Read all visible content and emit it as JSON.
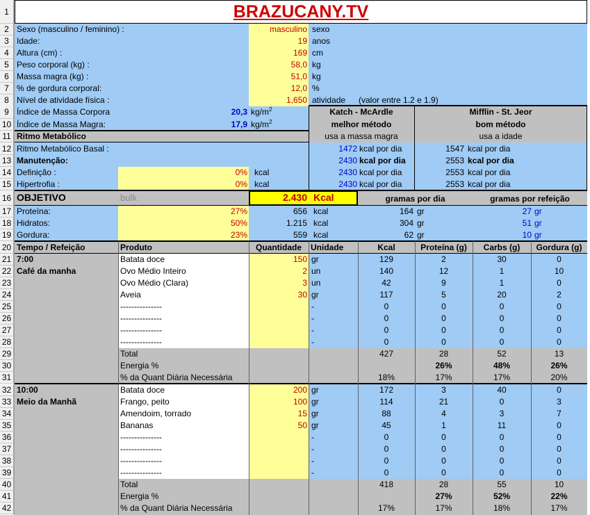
{
  "title": "BRAZUCANY.TV",
  "profile": [
    {
      "label": "Sexo (masculino / feminino) :",
      "value": "masculino",
      "unit": "sexo"
    },
    {
      "label": "Idade:",
      "value": "19",
      "unit": "anos"
    },
    {
      "label": "Altura (cm) :",
      "value": "169",
      "unit": "cm"
    },
    {
      "label": "Peso corporal (kg) :",
      "value": "58,0",
      "unit": "kg"
    },
    {
      "label": "Massa magra (kg) :",
      "value": "51,0",
      "unit": "kg"
    },
    {
      "label": "% de gordura corporal:",
      "value": "12,0",
      "unit": "%"
    },
    {
      "label": "Nível de atividade física :",
      "value": "1,650",
      "unit": "atividade",
      "note": "(valor entre 1.2 e 1.9)"
    }
  ],
  "indices": [
    {
      "label": "Índice de Massa Corpora",
      "value": "20,3",
      "unit": "kg/m",
      "exp": "2"
    },
    {
      "label": "Índice de Massa Magra:",
      "value": "17,9",
      "unit": "kg/m",
      "exp": "2"
    }
  ],
  "methods": {
    "katch": {
      "name": "Katch - McArdle",
      "quality": "melhor método",
      "basis": "usa a massa magra"
    },
    "mifflin": {
      "name": "Mifflin - St. Jeor",
      "quality": "bom método",
      "basis": "usa a idade"
    }
  },
  "rmb": {
    "section": "Ritmo Metabólico",
    "rows": [
      {
        "label": "Ritmo Metabólico Basal :",
        "pct": "",
        "pctunit": "",
        "k": "1472",
        "kunit": "kcal por dia",
        "m": "1547",
        "munit": "kcal por dia",
        "bold": false
      },
      {
        "label": "Manutenção:",
        "pct": "",
        "pctunit": "",
        "k": "2430",
        "kunit": "kcal por dia",
        "m": "2553",
        "munit": "kcal por dia",
        "bold": true
      },
      {
        "label": "Definição :",
        "pct": "0%",
        "pctunit": "kcal",
        "k": "2430",
        "kunit": "kcal por dia",
        "m": "2553",
        "munit": "kcal por dia",
        "bold": false
      },
      {
        "label": "Hipertrofia :",
        "pct": "0%",
        "pctunit": "kcal",
        "k": "2430",
        "kunit": "kcal por dia",
        "m": "2553",
        "munit": "kcal por dia",
        "bold": false
      }
    ]
  },
  "objective": {
    "label": "OBJETIVO",
    "mode": "bulk",
    "kcal": "2.430",
    "kcal_unit": "Kcal",
    "per_day": "gramas por dia",
    "per_meal": "gramas por refeição"
  },
  "macros": [
    {
      "label": "Proteína:",
      "pct": "27%",
      "kcal": "656",
      "unit": "kcal",
      "gday": "164",
      "gunit": "gr",
      "gmeal": "27",
      "gmunit": "gr"
    },
    {
      "label": "Hidratos:",
      "pct": "50%",
      "kcal": "1.215",
      "unit": "kcal",
      "gday": "304",
      "gunit": "gr",
      "gmeal": "51",
      "gmunit": "gr"
    },
    {
      "label": "Gordura:",
      "pct": "23%",
      "kcal": "559",
      "unit": "kcal",
      "gday": "62",
      "gunit": "gr",
      "gmeal": "10",
      "gmunit": "gr"
    }
  ],
  "table_headers": [
    "Tempo / Refeição",
    "Produto",
    "Quantidade",
    "Unidade",
    "Kcal",
    "Proteína (g)",
    "Carbs (g)",
    "Gordura (g)"
  ],
  "meals": [
    {
      "time": "7:00",
      "name": "Café da manha",
      "items": [
        {
          "product": "Batata doce",
          "qty": "150",
          "unit": "gr",
          "kcal": "129",
          "p": "2",
          "c": "30",
          "f": "0"
        },
        {
          "product": "Ovo Médio Inteiro",
          "qty": "2",
          "unit": "un",
          "kcal": "140",
          "p": "12",
          "c": "1",
          "f": "10"
        },
        {
          "product": "Ovo Médio (Clara)",
          "qty": "3",
          "unit": "un",
          "kcal": "42",
          "p": "9",
          "c": "1",
          "f": "0"
        },
        {
          "product": "Aveia",
          "qty": "30",
          "unit": "gr",
          "kcal": "117",
          "p": "5",
          "c": "20",
          "f": "2"
        },
        {
          "product": "---------------",
          "qty": "",
          "unit": "-",
          "kcal": "0",
          "p": "0",
          "c": "0",
          "f": "0"
        },
        {
          "product": "---------------",
          "qty": "",
          "unit": "-",
          "kcal": "0",
          "p": "0",
          "c": "0",
          "f": "0"
        },
        {
          "product": "---------------",
          "qty": "",
          "unit": "-",
          "kcal": "0",
          "p": "0",
          "c": "0",
          "f": "0"
        },
        {
          "product": "---------------",
          "qty": "",
          "unit": "-",
          "kcal": "0",
          "p": "0",
          "c": "0",
          "f": "0"
        }
      ],
      "total_label": "Total",
      "total": {
        "kcal": "427",
        "p": "28",
        "c": "52",
        "f": "13"
      },
      "energy_label": "Energia %",
      "energy": {
        "p": "26%",
        "c": "48%",
        "f": "26%"
      },
      "daily_label": "% da Quant Diária Necessária",
      "daily": {
        "kcal": "18%",
        "p": "17%",
        "c": "17%",
        "f": "20%"
      }
    },
    {
      "time": "10:00",
      "name": "Meio da Manhã",
      "items": [
        {
          "product": "Batata doce",
          "qty": "200",
          "unit": "gr",
          "kcal": "172",
          "p": "3",
          "c": "40",
          "f": "0"
        },
        {
          "product": "Frango, peito",
          "qty": "100",
          "unit": "gr",
          "kcal": "114",
          "p": "21",
          "c": "0",
          "f": "3"
        },
        {
          "product": "Amendoim, torrado",
          "qty": "15",
          "unit": "gr",
          "kcal": "88",
          "p": "4",
          "c": "3",
          "f": "7"
        },
        {
          "product": "Bananas",
          "qty": "50",
          "unit": "gr",
          "kcal": "45",
          "p": "1",
          "c": "11",
          "f": "0"
        },
        {
          "product": "---------------",
          "qty": "",
          "unit": "-",
          "kcal": "0",
          "p": "0",
          "c": "0",
          "f": "0"
        },
        {
          "product": "---------------",
          "qty": "",
          "unit": "-",
          "kcal": "0",
          "p": "0",
          "c": "0",
          "f": "0"
        },
        {
          "product": "---------------",
          "qty": "",
          "unit": "-",
          "kcal": "0",
          "p": "0",
          "c": "0",
          "f": "0"
        },
        {
          "product": "---------------",
          "qty": "",
          "unit": "-",
          "kcal": "0",
          "p": "0",
          "c": "0",
          "f": "0"
        }
      ],
      "total_label": "Total",
      "total": {
        "kcal": "418",
        "p": "28",
        "c": "55",
        "f": "10"
      },
      "energy_label": "Energia %",
      "energy": {
        "p": "27%",
        "c": "52%",
        "f": "22%"
      },
      "daily_label": "% da Quant Diária Necessária",
      "daily": {
        "kcal": "17%",
        "p": "17%",
        "c": "18%",
        "f": "17%"
      }
    }
  ],
  "colors": {
    "blue": "#9fcbf5",
    "yellow": "#ffff99",
    "gray": "#c0c0c0",
    "objective": "#ffff00",
    "title": "#cc0000"
  }
}
